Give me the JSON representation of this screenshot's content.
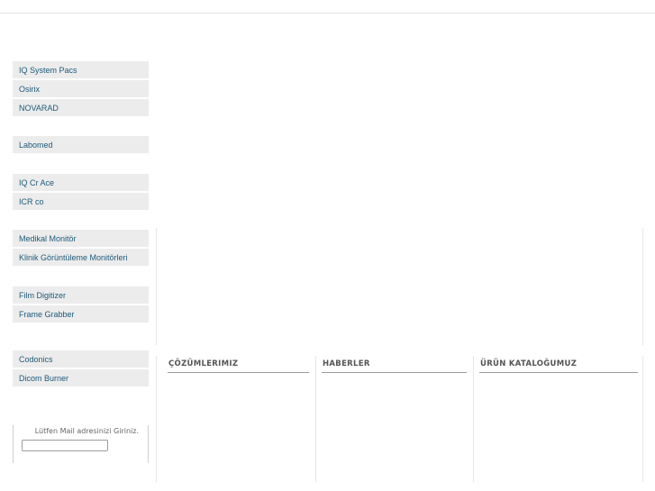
{
  "sidebar": {
    "groups": [
      {
        "items": [
          {
            "label": "IQ System Pacs"
          },
          {
            "label": "Osirix"
          },
          {
            "label": "NOVARAD"
          }
        ]
      },
      {
        "items": [
          {
            "label": "Labomed"
          }
        ]
      },
      {
        "items": [
          {
            "label": "IQ Cr Ace"
          },
          {
            "label": "ICR co"
          }
        ]
      },
      {
        "items": [
          {
            "label": "Medikal Monitör"
          },
          {
            "label": "Klinik Görüntüleme Monitörleri"
          }
        ]
      },
      {
        "items": [
          {
            "label": "Film Digitizer"
          },
          {
            "label": "Frame Grabber"
          }
        ]
      },
      {
        "items": [
          {
            "label": "Codonics"
          },
          {
            "label": "Dicom Burner"
          }
        ]
      }
    ]
  },
  "newsletter": {
    "label": "Lütfen Mail adresinizi Giriniz.",
    "input_value": ""
  },
  "sections": {
    "solutions": "ÇÖZÜMLERIMIZ",
    "news": "HABERLER",
    "catalog": "ÜRÜN KATALOĞUMUZ"
  },
  "colors": {
    "link_text": "#1d5a7a",
    "sidebar_bg": "#ececec",
    "rule": "#e6e6e6"
  }
}
